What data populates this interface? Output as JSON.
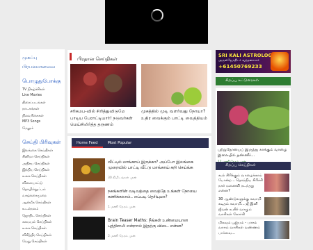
{
  "video": {
    "state": "loading"
  },
  "sidebar": {
    "top_links": [
      "முகப்பு",
      "பிரபலமானவை"
    ],
    "entertainment_heading": "பொழுதுபோக்கு",
    "entertainment_items": [
      "TV நிகழ்ச்சிகள்",
      "Live Movies",
      "திரைப்படங்கள்",
      "நாடகங்கள்",
      "நிலவரிசைகள்",
      "MP3 Songs",
      "மேலும்"
    ],
    "news_heading": "செய்தி பிரிவுகள்",
    "news_items": [
      "இலங்கை செய்திகள்",
      "சினிமா செய்திகள்",
      "அதிசய செய்திகள்",
      "இந்திய செய்திகள்",
      "உலக செய்திகள்",
      "விளையாட்டு",
      "தொழில்நுட்பம்",
      "வாழ்க்கைமுறை",
      "ஆன்மீக செய்திகள்",
      "உடல்நலம்",
      "ஜோதிட செய்திகள்",
      "சமையல் செய்திகள்",
      "உலக செய்திகள்",
      "விசித்திர செய்திகள்",
      "வேறு செய்திகள்"
    ]
  },
  "featured": {
    "section_title": "பிரதான செய்திகள்",
    "items": [
      {
        "title": "சரிகமப-வில் சிரித்துவிடுமே பாடிய பேராட்டியார்! நடுவர்கள் மெய்சிலிர்த்த தருணம்"
      },
      {
        "title": "முகத்தில் முடி வளர்வது நோயா? உதிர வைக்கும் பாட்டி வைத்தியம்"
      }
    ]
  },
  "feed": {
    "tabs": [
      "Home Feed",
      "Most Popular"
    ],
    "items": [
      {
        "title": "வீட்டில் மாங்காய் இருக்கா? அப்போ இலங்கை முறையில் பாட்டி வீட்டு மாங்காய் கறி செய்ங்க",
        "time": "30 நிமிடங்கள் முன்"
      },
      {
        "title": "நகங்களின் வடிவத்தை வைத்தே உங்கள் நோயை கணிக்கலாம்.. எப்படி தெரியுமா?",
        "time": "1 மணி நேரம் முன்"
      },
      {
        "title": "Brain Teaser Maths: நீங்கள் உண்மையான புத்திசாலி என்றால் இதற்கு விடை என்ன?",
        "time": "2 மணி நேரம் முன்"
      }
    ]
  },
  "right": {
    "ad": {
      "line1": "SRI KALI ASTROLOGER",
      "line2": "அருள்ஜோதிடர் வந்தனாசார்",
      "line3": "+61450769233"
    },
    "articles_title": "சிறப்பு கட்டுரைகள்",
    "article": {
      "title": "புற்றுநோயைப் இருந்து காக்கும் வாழை இலையில் தண்ணீர்...",
      "time": "12 மணி நேரம் முன்"
    },
    "special_title": "சிறப்பு செய்திகள்",
    "special_items": [
      {
        "title": "கூல் சிரிக்கும் வாழைக்காய் போன்ற... தொந்நிய சிரிச்சி நகர் மனைவி நடந்தது என்ன?",
        "time": ""
      },
      {
        "title": "30 ஆண்டுகளுக்கு சுவாமி கடிதம் சுவாமி... ஜீ இனி ஜீவன் உயிர் வாழும் வாசிகள் கோர்கி",
        "time": ""
      },
      {
        "title": "மிகவும் பூஜ்யம் - பாசம் வாசம் வாசிகள் வண்ணம் பார்வை...",
        "time": ""
      }
    ]
  },
  "colors": {
    "accent_red": "#c62828",
    "navy": "#2b2f52",
    "green": "#2e7d32",
    "link": "#2a5db0"
  }
}
